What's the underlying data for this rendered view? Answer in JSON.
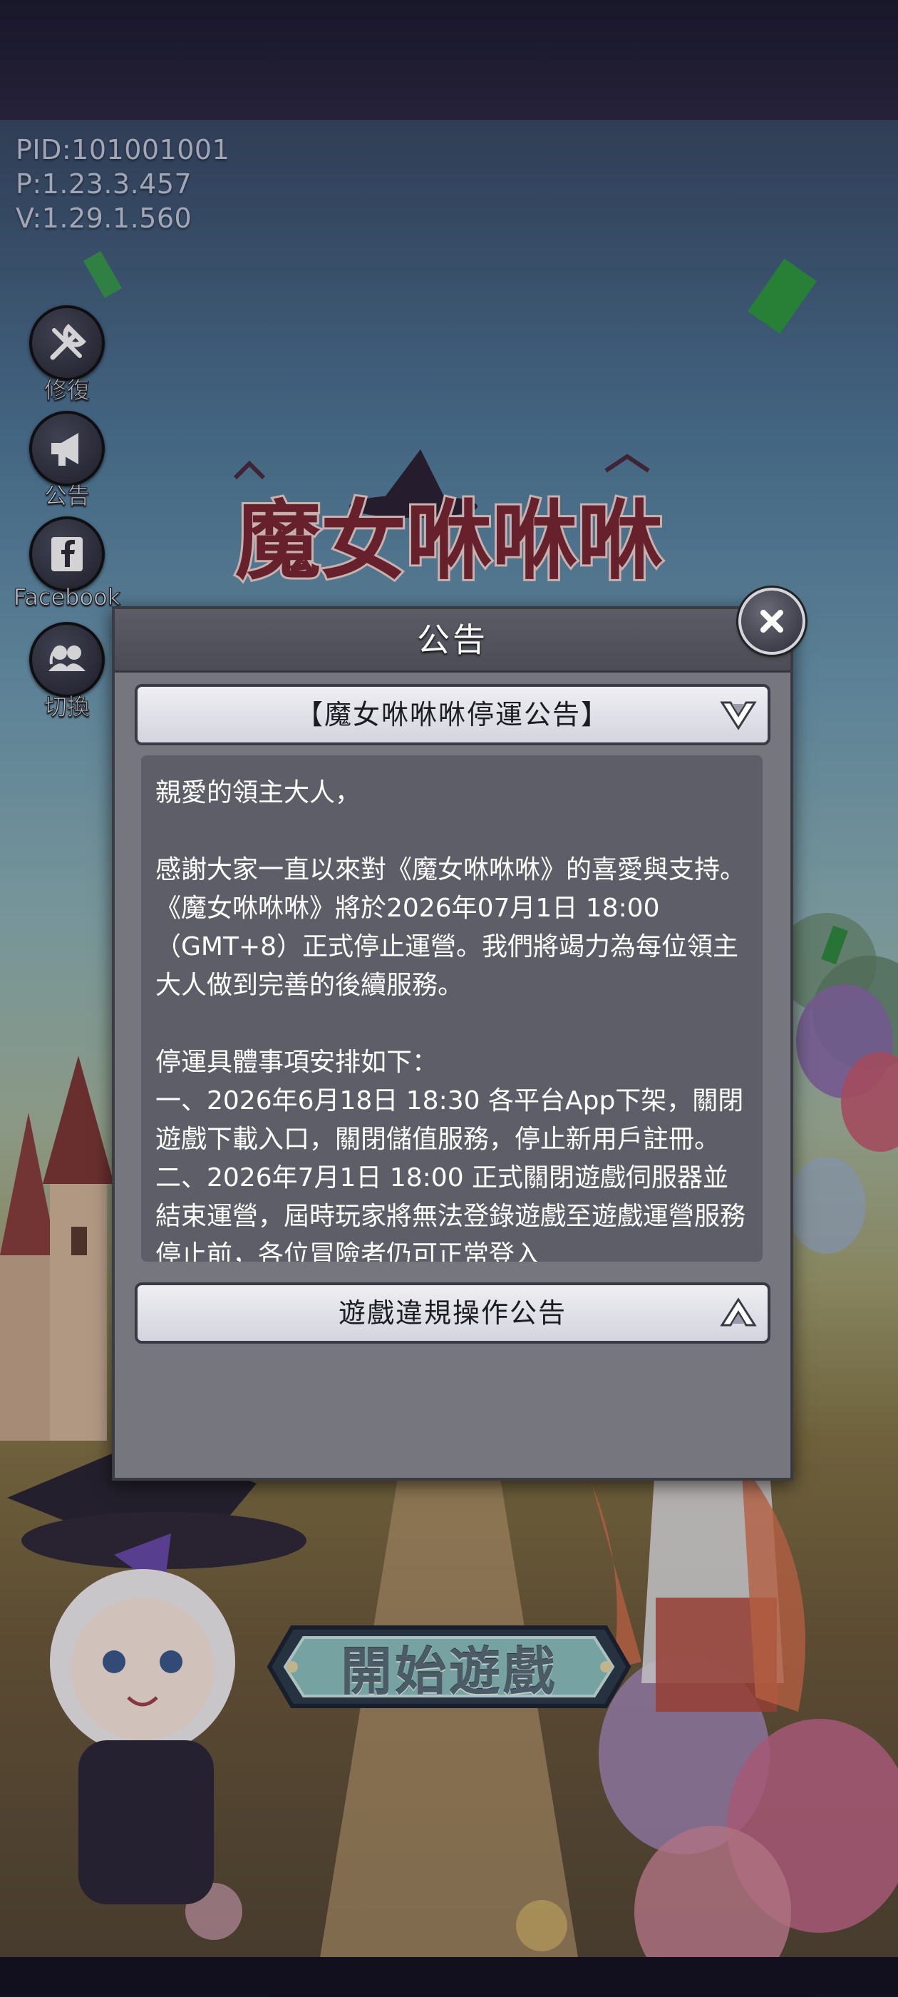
{
  "game": {
    "version_info": {
      "pid": "PID:101001001",
      "p": "P:1.23.3.457",
      "v": "V:1.29.1.560"
    },
    "logo_text": "魔女咻咻咻",
    "side_menu": [
      {
        "label": "修復",
        "icon": "wrench-screwdriver-icon"
      },
      {
        "label": "公告",
        "icon": "megaphone-icon"
      },
      {
        "label": "Facebook",
        "icon": "facebook-icon"
      },
      {
        "label": "切換",
        "icon": "switch-account-icon"
      }
    ],
    "start_button_label": "開始遊戲"
  },
  "dialog": {
    "title": "公告",
    "close_icon": "close-icon",
    "sections": [
      {
        "title": "【魔女咻咻咻停運公告】",
        "expanded": true,
        "toggle_icon": "chevron-down-icon",
        "body": "親愛的領主大人，\n\n感謝大家一直以來對《魔女咻咻咻》的喜愛與支持。\n《魔女咻咻咻》將於2026年07月1日 18:00 （GMT+8）正式停止運營。我們將竭力為每位領主大人做到完善的後續服務。\n\n停運具體事項安排如下：\n一、2026年6月18日 18:30 各平台App下架，關閉遊戲下載入口，關閉儲值服務，停止新用戶註冊。\n二、2026年7月1日 18:00 正式關閉遊戲伺服器並結束運營，屆時玩家將無法登錄遊戲至遊戲運營服務停止前，各位冒險者仍可正常登入"
      },
      {
        "title": "遊戲違規操作公告",
        "expanded": false,
        "toggle_icon": "chevron-up-icon"
      }
    ]
  },
  "colors": {
    "dialog_bg": "#76767f",
    "header_bg": "#4c4c56",
    "content_bg": "#5e5e68",
    "accordion_bg": "#e4e4ec"
  }
}
